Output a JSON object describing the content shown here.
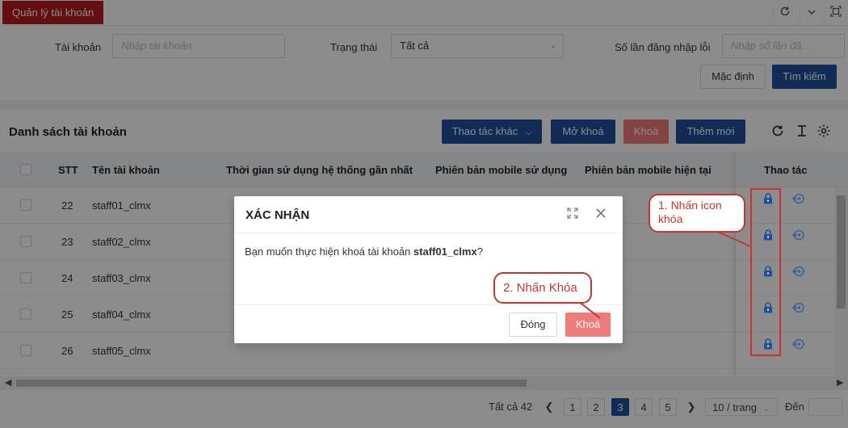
{
  "app": {
    "active_tab": "Quản lý tài khoản",
    "window_icons": [
      "refresh-icon",
      "chevron-down-icon",
      "fullscreen-icon"
    ]
  },
  "filters": {
    "account_label": "Tài khoản",
    "account_placeholder": "Nhập tài khoản",
    "status_label": "Trạng thái",
    "status_value": "Tất cả",
    "login_errors_label": "Số lần đăng nhập lỗi",
    "login_errors_placeholder": "Nhập số lần đă...",
    "default_button": "Mặc định",
    "search_button": "Tìm kiếm"
  },
  "list": {
    "title": "Danh sách tài khoản",
    "other_actions_button": "Thao tác khác",
    "unlock_button": "Mở khoá",
    "lock_button": "Khoá",
    "add_button": "Thêm mới",
    "columns": {
      "stt": "STT",
      "username": "Tên tài khoản",
      "last_used": "Thời gian sử dụng hệ thống gần nhất",
      "mobile_version_used": "Phiên bản mobile sử dụng",
      "mobile_version_current": "Phiên bản mobile hiện tại",
      "actions": "Thao tác"
    },
    "rows": [
      {
        "stt": "22",
        "username": "staff01_clmx"
      },
      {
        "stt": "23",
        "username": "staff02_clmx"
      },
      {
        "stt": "24",
        "username": "staff03_clmx"
      },
      {
        "stt": "25",
        "username": "staff04_clmx"
      },
      {
        "stt": "26",
        "username": "staff05_clmx"
      }
    ]
  },
  "pagination": {
    "total": "Tất cả 42",
    "pages": [
      "1",
      "2",
      "3",
      "4",
      "5"
    ],
    "current_page": "3",
    "page_size": "10 / trang",
    "goto_label": "Đến"
  },
  "modal": {
    "title": "XÁC NHẬN",
    "message_prefix": "Bạn muốn thực hiện khoá tài khoản ",
    "message_account": "staff01_clmx",
    "message_suffix": "?",
    "close_button": "Đóng",
    "lock_button": "Khoá"
  },
  "annotations": {
    "step1": "1. Nhấn icon khóa",
    "step2": "2. Nhấn Khóa"
  },
  "colors": {
    "primary": "#1e4f9c",
    "danger": "#ef7b7b",
    "tab_red": "#b71c1c",
    "annotation_red": "#c0392b"
  }
}
